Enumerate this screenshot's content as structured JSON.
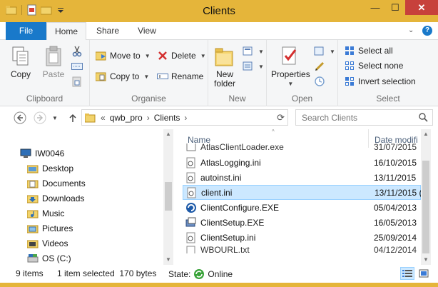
{
  "window": {
    "title": "Clients",
    "accent": "#e5b53a",
    "close_color": "#c7413b"
  },
  "controls": {
    "minimize": "—",
    "maximize": "☐",
    "close": "✕"
  },
  "tabs": {
    "file": "File",
    "home": "Home",
    "share": "Share",
    "view": "View",
    "help": "?"
  },
  "ribbon": {
    "clipboard": {
      "label": "Clipboard",
      "copy": "Copy",
      "paste": "Paste"
    },
    "organise": {
      "label": "Organise",
      "move_to": "Move to",
      "copy_to": "Copy to",
      "delete": "Delete",
      "rename": "Rename"
    },
    "new": {
      "label": "New",
      "new_folder_line1": "New",
      "new_folder_line2": "folder"
    },
    "open": {
      "label": "Open",
      "properties": "Properties"
    },
    "select": {
      "label": "Select",
      "select_all": "Select all",
      "select_none": "Select none",
      "invert_selection": "Invert selection"
    }
  },
  "address": {
    "prefix": "«",
    "crumbs": [
      "qwb_pro",
      "Clients"
    ],
    "search_placeholder": "Search Clients"
  },
  "nav_tree": [
    {
      "label": "IW0046",
      "icon": "computer-icon"
    },
    {
      "label": "Desktop",
      "icon": "folder-icon"
    },
    {
      "label": "Documents",
      "icon": "folder-icon"
    },
    {
      "label": "Downloads",
      "icon": "folder-icon"
    },
    {
      "label": "Music",
      "icon": "folder-icon"
    },
    {
      "label": "Pictures",
      "icon": "folder-icon"
    },
    {
      "label": "Videos",
      "icon": "folder-icon"
    },
    {
      "label": "OS (C:)",
      "icon": "drive-icon"
    }
  ],
  "columns": {
    "name": "Name",
    "date": "Date modifi"
  },
  "files": [
    {
      "name": "AtlasClientLoader.exe",
      "date": "31/07/2015",
      "icon": "exe-icon",
      "selected": false
    },
    {
      "name": "AtlasLogging.ini",
      "date": "16/10/2015",
      "icon": "ini-icon",
      "selected": false
    },
    {
      "name": "autoinst.ini",
      "date": "13/11/2015",
      "icon": "ini-icon",
      "selected": false
    },
    {
      "name": "client.ini",
      "date": "13/11/2015 (",
      "icon": "ini-icon",
      "selected": true
    },
    {
      "name": "ClientConfigure.EXE",
      "date": "05/04/2013",
      "icon": "configure-icon",
      "selected": false
    },
    {
      "name": "ClientSetup.EXE",
      "date": "16/05/2013",
      "icon": "setup-icon",
      "selected": false
    },
    {
      "name": "ClientSetup.ini",
      "date": "25/09/2014",
      "icon": "ini-icon",
      "selected": false
    },
    {
      "name": "WBOURL.txt",
      "date": "04/12/2014",
      "icon": "txt-icon",
      "selected": false
    }
  ],
  "status": {
    "items": "9 items",
    "selected": "1 item selected  170 bytes",
    "state_label": "State:",
    "state_value": "Online"
  }
}
